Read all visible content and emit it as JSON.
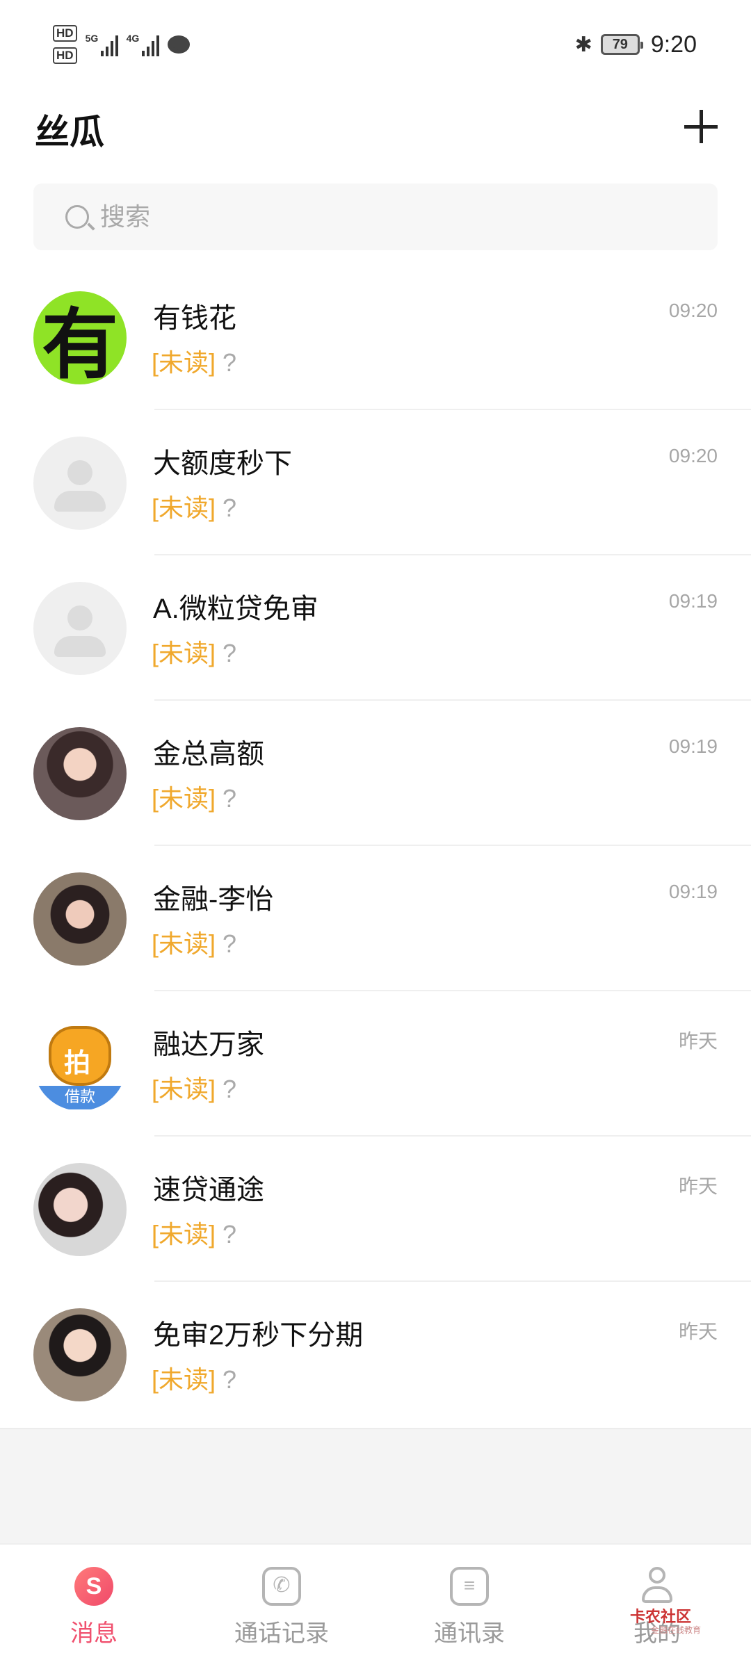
{
  "status_bar": {
    "hd1": "HD",
    "hd2": "HD",
    "net1": "5G",
    "net2": "4G",
    "battery": "79",
    "time": "9:20",
    "bluetooth_icon": "bluetooth-icon"
  },
  "header": {
    "title": "丝瓜",
    "add_icon": "plus-icon"
  },
  "search": {
    "placeholder": "搜索"
  },
  "conversations": [
    {
      "name": "有钱花",
      "time": "09:20",
      "unread": "[未读]",
      "preview": "?",
      "avatar": "有"
    },
    {
      "name": "大额度秒下",
      "time": "09:20",
      "unread": "[未读]",
      "preview": "?"
    },
    {
      "name": "A.微粒贷免审",
      "time": "09:19",
      "unread": "[未读]",
      "preview": "?"
    },
    {
      "name": "金总高额",
      "time": "09:19",
      "unread": "[未读]",
      "preview": "?"
    },
    {
      "name": "金融-李怡",
      "time": "09:19",
      "unread": "[未读]",
      "preview": "?"
    },
    {
      "name": "融达万家",
      "time": "昨天",
      "unread": "[未读]",
      "preview": "?",
      "avatar_top": "拍",
      "avatar_band": "借款"
    },
    {
      "name": "速贷通途",
      "time": "昨天",
      "unread": "[未读]",
      "preview": "?"
    },
    {
      "name": "免审2万秒下分期",
      "time": "昨天",
      "unread": "[未读]",
      "preview": "?"
    }
  ],
  "bottom_nav": {
    "tabs": [
      {
        "label": "消息",
        "icon": "message-icon",
        "active": true
      },
      {
        "label": "通话记录",
        "icon": "call-log-icon",
        "active": false
      },
      {
        "label": "通讯录",
        "icon": "contacts-icon",
        "active": false
      },
      {
        "label": "我的",
        "icon": "profile-icon",
        "active": false
      }
    ]
  },
  "watermark": {
    "text": "卡农社区",
    "sub": "金融在线教育"
  },
  "colors": {
    "accent": "#f0506e",
    "unread": "#f0a82c",
    "muted": "#a6a6a6"
  }
}
